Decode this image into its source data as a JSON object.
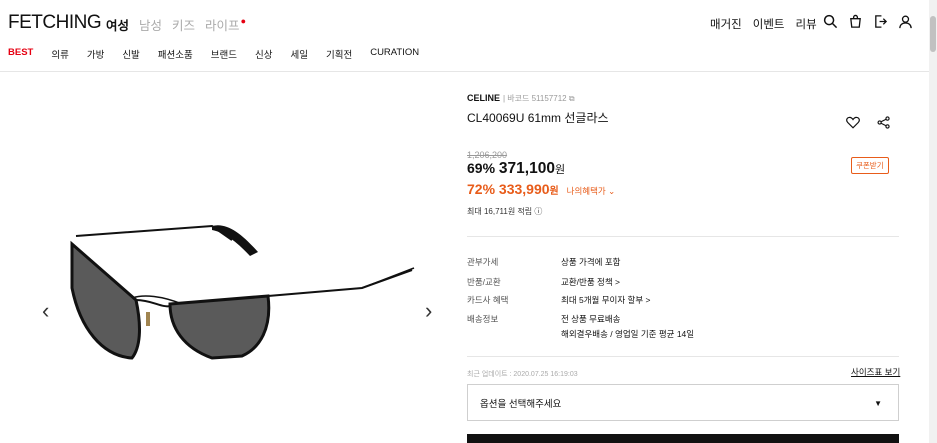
{
  "header": {
    "logo": "FETCHING",
    "topnav": [
      {
        "label": "여성",
        "active": true
      },
      {
        "label": "남성",
        "active": false
      },
      {
        "label": "키즈",
        "active": false
      },
      {
        "label": "라이프",
        "active": false
      }
    ],
    "right_links": [
      "매거진",
      "이벤트",
      "리뷰"
    ],
    "icons": [
      "search-icon",
      "cart-icon",
      "logout-icon",
      "user-icon"
    ],
    "categories": [
      "BEST",
      "의류",
      "가방",
      "신발",
      "패션소품",
      "브랜드",
      "신상",
      "세일",
      "기획전",
      "CURATION"
    ]
  },
  "product": {
    "brand": "CELINE",
    "barcode": "| 바코드 51157712",
    "title": "CL40069U 61mm 선글라스",
    "original_price": "1,206,200",
    "discount1": "69%",
    "price1": "371,100",
    "won": "원",
    "discount2": "72%",
    "price2": "333,990",
    "benefit_label": "나의혜택가",
    "coupon_label": "쿠폰받기",
    "points": "최대 16,711원 적립",
    "info": [
      {
        "key": "관부가세",
        "value": "상품 가격에 포함"
      },
      {
        "key": "반품/교환",
        "value": "교환/반품 정책 >"
      },
      {
        "key": "카드사 혜택",
        "value": "최대 5개월 무이자 할부 >"
      },
      {
        "key": "배송정보",
        "value": "전 상품 무료배송"
      },
      {
        "key": "",
        "value": "해외결우배송 / 영업일 기준 평균 14일"
      }
    ],
    "updated": "최근 업데이트 : 2020.07.25 16:19:03",
    "size_guide": "사이즈표 보기",
    "option_placeholder": "옵션을 선택해주세요"
  },
  "colors": {
    "accent_red": "#e60012",
    "accent_orange": "#e85c1a"
  }
}
